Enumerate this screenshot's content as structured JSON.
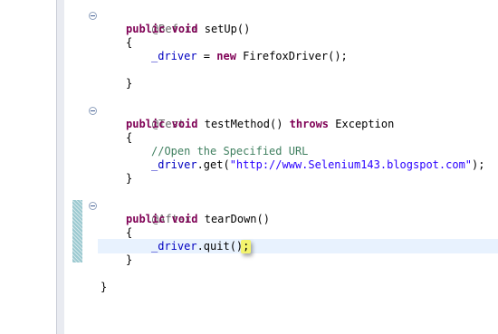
{
  "colors": {
    "keyword": "#7f0055",
    "annotation": "#646464",
    "field": "#0000c0",
    "string": "#2a00ff",
    "comment": "#3f7f5f",
    "current_line": "#e8f2fe",
    "highlight": "#f4f46e"
  },
  "code": {
    "before_annotation": "@Before",
    "setup_sig": {
      "kw1": "public",
      "kw2": "void",
      "rest": "setUp()"
    },
    "open_brace": "{",
    "close_brace": "}",
    "setup_body": {
      "field": "_driver",
      "mid": " = ",
      "kw": "new",
      "rest": " FirefoxDriver();"
    },
    "test_annotation": "@Test",
    "test_sig": {
      "kw1": "public",
      "kw2": "void",
      "name": "testMethod()",
      "kw3": "throws",
      "rest": "Exception"
    },
    "test_comment": "//Open the Specified URL",
    "test_body": {
      "field": "_driver",
      "mid": ".get(",
      "str": "\"http://www.Selenium143.blogspot.com\"",
      "rest": ");"
    },
    "after_annotation": "@After",
    "teardown_sig": {
      "kw1": "public",
      "kw2": "void",
      "rest": "tearDown()"
    },
    "teardown_body": {
      "field": "_driver",
      "mid": ".quit()",
      "highlight": ";"
    },
    "class_close": "}"
  }
}
